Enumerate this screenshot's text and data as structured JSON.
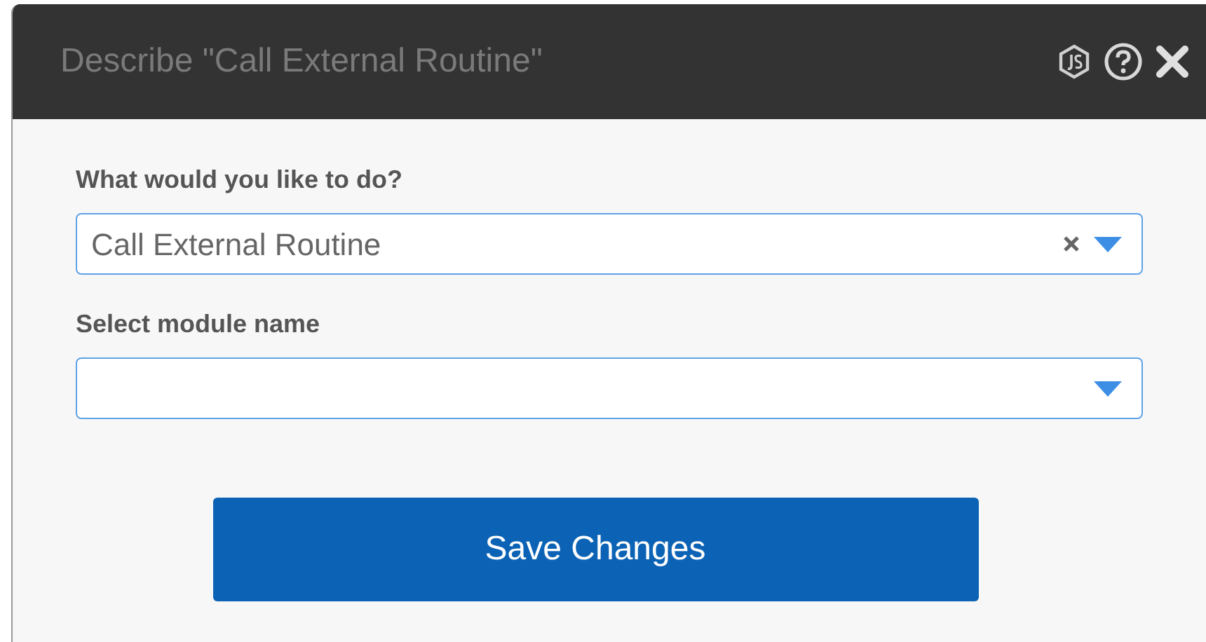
{
  "dialog": {
    "title": "Describe \"Call External Routine\""
  },
  "fields": [
    {
      "label": "What would you like to do?",
      "value": "Call External Routine"
    },
    {
      "label": "Select module name"
    }
  ],
  "button": {
    "label": "Save Changes"
  }
}
